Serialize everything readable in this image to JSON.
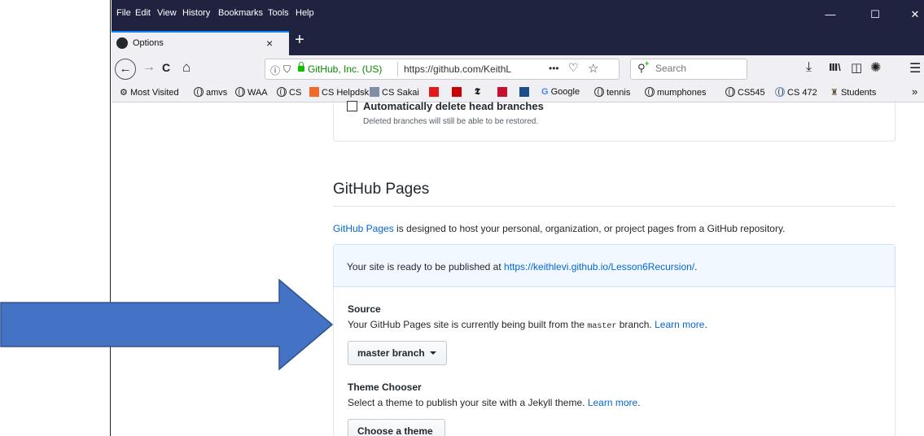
{
  "menu": [
    "File",
    "Edit",
    "View",
    "History",
    "Bookmarks",
    "Tools",
    "Help"
  ],
  "window_controls": {
    "minimize": "—",
    "maximize": "☐",
    "close": "✕"
  },
  "tab": {
    "title": "Options",
    "close": "×",
    "new_tab": "+"
  },
  "nav": {
    "back": "←",
    "forward": "→",
    "reload": "C",
    "home": "⌂",
    "url_org": "GitHub, Inc. (US)",
    "url": "https://github.com/KeithL",
    "menu_dots": "•••",
    "search_placeholder": "Search",
    "download": "⤓",
    "library": "Ⅲ\\",
    "sidebar": "◫",
    "addon": "✺",
    "hamburger": "☰"
  },
  "bookmarks": [
    "Most Visited",
    "amvs",
    "WAA",
    "CS",
    "CS Helpdsk",
    "CS Sakai",
    "Google",
    "tennis",
    "mumphones",
    "CS545",
    "CS 472",
    "Students"
  ],
  "bookmarks_overflow": "»",
  "bookmark_glyphs": {
    "t1": "𝕿",
    "google_g": "G"
  },
  "content": {
    "auto_delete_label": "Automatically delete head branches",
    "auto_delete_note": "Deleted branches will still be able to be restored.",
    "pages_heading": "GitHub Pages",
    "pages_link": "GitHub Pages",
    "pages_desc": " is designed to host your personal, organization, or project pages from a GitHub repository.",
    "ready_prefix": "Your site is ready to be published at ",
    "ready_url": "https://keithlevi.github.io/Lesson6Recursion/",
    "ready_suffix": ".",
    "source_title": "Source",
    "source_prefix": "Your GitHub Pages site is currently being built from the ",
    "source_branch_code": "master",
    "source_suffix": " branch. ",
    "learn_more": "Learn more",
    "learn_more_suffix": ".",
    "branch_button": "master branch",
    "theme_title": "Theme Chooser",
    "theme_desc": "Select a theme to publish your site with a Jekyll theme. ",
    "theme_button": "Choose a theme"
  },
  "colors": {
    "arrow_fill": "#4472c4",
    "arrow_stroke": "#2f528f",
    "link": "#0366d6",
    "titlebar": "#202340"
  }
}
